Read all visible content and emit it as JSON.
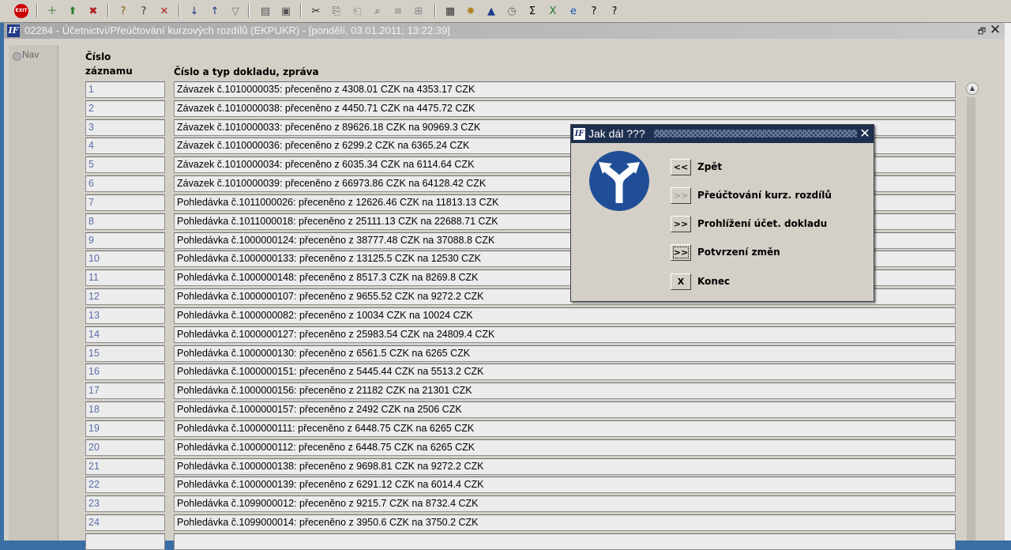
{
  "toolbar": {
    "icons": [
      {
        "name": "exit-icon",
        "glyph": "EXIT",
        "color": "#cc0000"
      },
      {
        "name": "new-record-icon",
        "glyph": "＋",
        "color": "#2a7a2a"
      },
      {
        "name": "insert-record-icon",
        "glyph": "⬆",
        "color": "#2a7a2a"
      },
      {
        "name": "delete-record-icon",
        "glyph": "✖",
        "color": "#b02020"
      },
      {
        "name": "query-icon",
        "glyph": "?",
        "color": "#7a5a10"
      },
      {
        "name": "execute-query-icon",
        "glyph": "?",
        "color": "#333333"
      },
      {
        "name": "cancel-query-icon",
        "glyph": "✕",
        "color": "#b02020"
      },
      {
        "name": "sort-asc-icon",
        "glyph": "↓",
        "color": "#1a3a8a"
      },
      {
        "name": "sort-desc-icon",
        "glyph": "↑",
        "color": "#1a3a8a"
      },
      {
        "name": "filter-icon",
        "glyph": "▽",
        "color": "#777777"
      },
      {
        "name": "print-icon",
        "glyph": "▤",
        "color": "#555555"
      },
      {
        "name": "print-preview-icon",
        "glyph": "▣",
        "color": "#555555"
      },
      {
        "name": "cut-icon",
        "glyph": "✂",
        "color": "#222222"
      },
      {
        "name": "copy-icon",
        "glyph": "⎘",
        "color": "#555555"
      },
      {
        "name": "paste-icon",
        "glyph": "⎗",
        "color": "#999999"
      },
      {
        "name": "zoom-icon",
        "glyph": "⌕",
        "color": "#555555"
      },
      {
        "name": "list-icon",
        "glyph": "≡",
        "color": "#888888"
      },
      {
        "name": "tree-icon",
        "glyph": "⊞",
        "color": "#888888"
      },
      {
        "name": "calendar-icon",
        "glyph": "▦",
        "color": "#333333"
      },
      {
        "name": "settings-icon",
        "glyph": "✹",
        "color": "#b08020"
      },
      {
        "name": "triangle-icon",
        "glyph": "▲",
        "color": "#1a3a8a"
      },
      {
        "name": "clock-icon",
        "glyph": "◷",
        "color": "#666666"
      },
      {
        "name": "sum-icon",
        "glyph": "Σ",
        "color": "#000000"
      },
      {
        "name": "excel-icon",
        "glyph": "X",
        "color": "#1d7a2e"
      },
      {
        "name": "browser-icon",
        "glyph": "e",
        "color": "#1a5ab0"
      },
      {
        "name": "help-icon",
        "glyph": "?",
        "color": "#000000"
      },
      {
        "name": "context-help-icon",
        "glyph": "?",
        "color": "#000000"
      }
    ]
  },
  "window": {
    "title": "02284 - Účetnictví/Přeúčtování kurzových rozdílů (EKPUKR) - [pondělí, 03.01.2011; 13:22:39]",
    "restore_glyph": "🗗",
    "close_glyph": "✕"
  },
  "nav": {
    "label": "Nav"
  },
  "table": {
    "col1_header_line1": "Číslo",
    "col1_header_line2": "záznamu",
    "col2_header": "Číslo a typ dokladu, zpráva",
    "rows": [
      {
        "num": "1",
        "text": "Závazek č.1010000035: přeceněno z 4308.01 CZK na 4353.17 CZK"
      },
      {
        "num": "2",
        "text": "Závazek č.1010000038: přeceněno z 4450.71 CZK na 4475.72 CZK"
      },
      {
        "num": "3",
        "text": "Závazek č.1010000033: přeceněno z 89626.18 CZK na 90969.3 CZK"
      },
      {
        "num": "4",
        "text": "Závazek č.1010000036: přeceněno z 6299.2 CZK na 6365.24 CZK"
      },
      {
        "num": "5",
        "text": "Závazek č.1010000034: přeceněno z 6035.34 CZK na 6114.64 CZK"
      },
      {
        "num": "6",
        "text": "Závazek č.1010000039: přeceněno z 66973.86 CZK na 64128.42 CZK"
      },
      {
        "num": "7",
        "text": "Pohledávka č.1011000026: přeceněno z 12626.46 CZK na 11813.13 CZK"
      },
      {
        "num": "8",
        "text": "Pohledávka č.1011000018: přeceněno z 25111.13 CZK na 22688.71 CZK"
      },
      {
        "num": "9",
        "text": "Pohledávka č.1000000124: přeceněno z 38777.48 CZK na 37088.8 CZK"
      },
      {
        "num": "10",
        "text": "Pohledávka č.1000000133: přeceněno z 13125.5 CZK na 12530 CZK"
      },
      {
        "num": "11",
        "text": "Pohledávka č.1000000148: přeceněno z 8517.3 CZK na 8269.8 CZK"
      },
      {
        "num": "12",
        "text": "Pohledávka č.1000000107: přeceněno z 9655.52 CZK na 9272.2 CZK"
      },
      {
        "num": "13",
        "text": "Pohledávka č.1000000082: přeceněno z 10034 CZK na 10024 CZK"
      },
      {
        "num": "14",
        "text": "Pohledávka č.1000000127: přeceněno z 25983.54 CZK na 24809.4 CZK"
      },
      {
        "num": "15",
        "text": "Pohledávka č.1000000130: přeceněno z 6561.5 CZK na 6265 CZK"
      },
      {
        "num": "16",
        "text": "Pohledávka č.1000000151: přeceněno z 5445.44 CZK na 5513.2 CZK"
      },
      {
        "num": "17",
        "text": "Pohledávka č.1000000156: přeceněno z 21182 CZK na 21301 CZK"
      },
      {
        "num": "18",
        "text": "Pohledávka č.1000000157: přeceněno z 2492 CZK na 2506 CZK"
      },
      {
        "num": "19",
        "text": "Pohledávka č.1000000111: přeceněno z 6448.75 CZK na 6265 CZK"
      },
      {
        "num": "20",
        "text": "Pohledávka č.1000000112: přeceněno z 6448.75 CZK na 6265 CZK"
      },
      {
        "num": "21",
        "text": "Pohledávka č.1000000138: přeceněno z 9698.81 CZK na 9272.2 CZK"
      },
      {
        "num": "22",
        "text": "Pohledávka č.1000000139: přeceněno z 6291.12 CZK na 6014.4 CZK"
      },
      {
        "num": "23",
        "text": "Pohledávka č.1099000012: přeceněno z 9215.7 CZK na 8732.4 CZK"
      },
      {
        "num": "24",
        "text": "Pohledávka č.1099000014: přeceněno z 3950.6 CZK na 3750.2 CZK"
      },
      {
        "num": "",
        "text": ""
      }
    ]
  },
  "scrollbar": {
    "up_glyph": "▲"
  },
  "dialog": {
    "title": "Jak dál ???",
    "close_glyph": "✕",
    "logo_text": "IF",
    "buttons": [
      {
        "label": "<<",
        "text": "Zpět",
        "state": "normal",
        "name": "back-button"
      },
      {
        "label": ">>",
        "text": "Přeúčtování kurz. rozdílů",
        "state": "disabled",
        "name": "rebook-button"
      },
      {
        "label": ">>",
        "text": "Prohlížení účet. dokladu",
        "state": "normal",
        "name": "view-document-button"
      },
      {
        "label": ">>",
        "text": "Potvrzení změn",
        "state": "focused",
        "name": "confirm-changes-button"
      },
      {
        "label": "X",
        "text": "Konec",
        "state": "normal",
        "name": "end-button"
      }
    ]
  },
  "colors": {
    "dialog_titlebar": "#1e2f4f",
    "sign_blue": "#1f4e96",
    "record_number": "#5a6ea8"
  }
}
